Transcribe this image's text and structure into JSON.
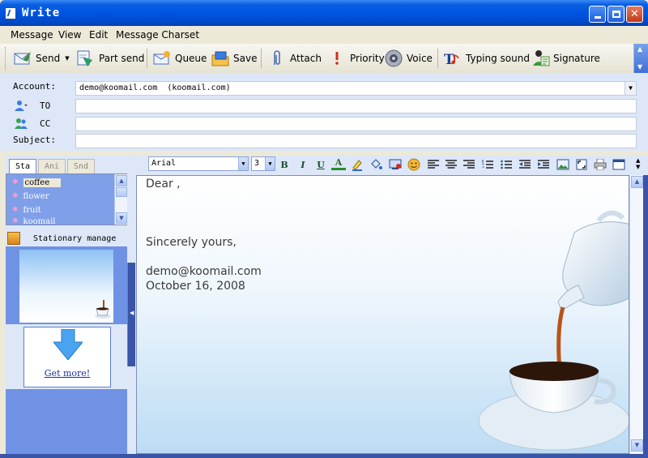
{
  "window": {
    "title": "Write"
  },
  "menu": [
    "Message",
    "View",
    "Edit",
    "Message Charset"
  ],
  "toolbar": {
    "send": "Send",
    "part_send": "Part send",
    "queue": "Queue",
    "save": "Save",
    "attach": "Attach",
    "priority": "Priority",
    "voice": "Voice",
    "typing_sound": "Typing sound",
    "signature": "Signature"
  },
  "header": {
    "account_label": "Account:",
    "account_value": "demo@koomail.com  (koomail.com)",
    "to_label": "TO",
    "to_value": "",
    "cc_label": "CC",
    "cc_value": "",
    "subject_label": "Subject:",
    "subject_value": ""
  },
  "stationery": {
    "tabs": [
      "Sta",
      "Ani",
      "Snd"
    ],
    "active_tab": "Sta",
    "items": [
      "coffee",
      "flower",
      "fruit",
      "koomail"
    ],
    "selected": "coffee",
    "manage_label": "Stationary manage",
    "get_more": "Get more!"
  },
  "format": {
    "font": "Arial",
    "size": "3"
  },
  "body": {
    "greeting": "Dear ,",
    "closing": "Sincerely yours,",
    "email": "demo@koomail.com",
    "date": "October 16, 2008"
  }
}
